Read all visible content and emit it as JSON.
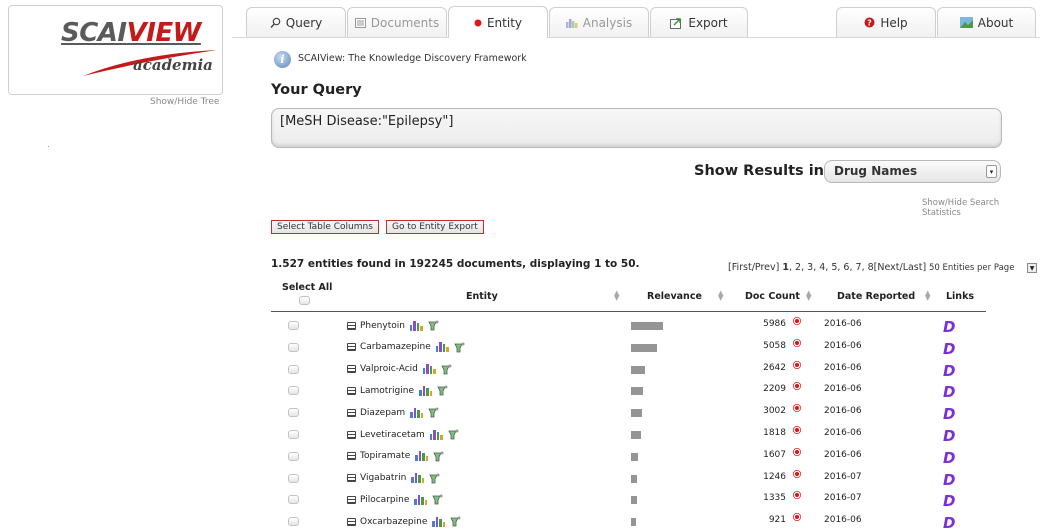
{
  "logo": {
    "main_gray": "SCAI",
    "main_red": "VIEW",
    "sub": "academia"
  },
  "left_panel": {
    "show_hide_tree": "Show/Hide Tree"
  },
  "tabs": [
    {
      "label": "Query",
      "icon": "search-icon",
      "state": "normal"
    },
    {
      "label": "Documents",
      "icon": "documents-icon",
      "state": "disabled"
    },
    {
      "label": "Entity",
      "icon": "red-dot-icon",
      "state": "active"
    },
    {
      "label": "Analysis",
      "icon": "bar-chart-icon",
      "state": "disabled"
    },
    {
      "label": "Export",
      "icon": "export-icon",
      "state": "normal"
    },
    {
      "label": "Help",
      "icon": "help-icon",
      "state": "normal"
    },
    {
      "label": "About",
      "icon": "about-icon",
      "state": "normal"
    }
  ],
  "header": {
    "framework_title": "SCAIView: The Knowledge Discovery Framework"
  },
  "query": {
    "heading": "Your Query",
    "value": "[MeSH Disease:\"Epilepsy\"]"
  },
  "results_in": {
    "label": "Show Results in:",
    "selected": "Drug Names"
  },
  "show_hide_stats": "Show/Hide Search Statistics",
  "buttons": {
    "select_columns": "Select Table Columns",
    "entity_export": "Go to Entity Export"
  },
  "summary": "1.527 entities found in 192245 documents, displaying 1 to 50.",
  "pagination": {
    "first_prev": "[First/Prev]",
    "pages": [
      "1",
      "2",
      "3",
      "4",
      "5",
      "6",
      "7",
      "8"
    ],
    "current": "1",
    "next_last": "[Next/Last]",
    "per_page": "50 Entities per Page"
  },
  "table": {
    "select_all": "Select All",
    "columns": {
      "entity": "Entity",
      "relevance": "Relevance",
      "doc_count": "Doc Count",
      "date_reported": "Date Reported",
      "links": "Links"
    },
    "link_glyph": "D",
    "rows": [
      {
        "entity": "Phenytoin",
        "relevance": 1.0,
        "doc_count": "5986",
        "date": "2016-06"
      },
      {
        "entity": "Carbamazepine",
        "relevance": 0.81,
        "doc_count": "5058",
        "date": "2016-06"
      },
      {
        "entity": "Valproic-Acid",
        "relevance": 0.43,
        "doc_count": "2642",
        "date": "2016-06"
      },
      {
        "entity": "Lamotrigine",
        "relevance": 0.36,
        "doc_count": "2209",
        "date": "2016-06"
      },
      {
        "entity": "Diazepam",
        "relevance": 0.33,
        "doc_count": "3002",
        "date": "2016-06"
      },
      {
        "entity": "Levetiracetam",
        "relevance": 0.3,
        "doc_count": "1818",
        "date": "2016-06"
      },
      {
        "entity": "Topiramate",
        "relevance": 0.23,
        "doc_count": "1607",
        "date": "2016-06"
      },
      {
        "entity": "Vigabatrin",
        "relevance": 0.2,
        "doc_count": "1246",
        "date": "2016-07"
      },
      {
        "entity": "Pilocarpine",
        "relevance": 0.18,
        "doc_count": "1335",
        "date": "2016-07"
      },
      {
        "entity": "Oxcarbazepine",
        "relevance": 0.16,
        "doc_count": "921",
        "date": "2016-06"
      }
    ]
  }
}
